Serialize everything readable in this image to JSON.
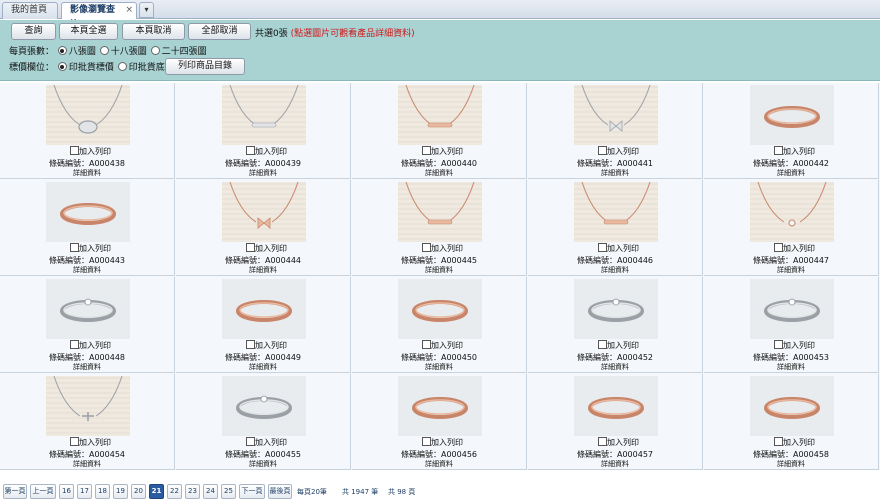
{
  "tabs": {
    "home": "我的首頁",
    "active": "影像瀏覽查詢",
    "close": "×",
    "menu": "▾"
  },
  "toolbar": {
    "query": "查詢",
    "select_page": "本頁全選",
    "cancel_page": "本頁取消",
    "cancel_all": "全部取消",
    "total": "共選0張",
    "hint": "(點選圖片可觀看產品詳細資料)",
    "print_catalog": "列印商品目錄"
  },
  "options": {
    "per_page_label": "每頁張數：",
    "per_page": [
      "八張圖",
      "十八張圖",
      "二十四張圖"
    ],
    "price_label": "標價欄位：",
    "price": [
      "印批貨標價",
      "印批貨底價"
    ]
  },
  "product_labels": {
    "add_print": "加入列印",
    "code_prefix": "條碼編號：",
    "detail": "詳細資料"
  },
  "products": [
    {
      "code": "A000438",
      "kind": "necklace",
      "metal": "silver",
      "charm": "oval"
    },
    {
      "code": "A000439",
      "kind": "necklace",
      "metal": "silver",
      "charm": "bar"
    },
    {
      "code": "A000440",
      "kind": "necklace",
      "metal": "rose",
      "charm": "bar"
    },
    {
      "code": "A000441",
      "kind": "necklace",
      "metal": "silver",
      "charm": "bow"
    },
    {
      "code": "A000442",
      "kind": "ring",
      "metal": "rose"
    },
    {
      "code": "A000443",
      "kind": "ring",
      "metal": "rose"
    },
    {
      "code": "A000444",
      "kind": "necklace",
      "metal": "rose",
      "charm": "bow"
    },
    {
      "code": "A000445",
      "kind": "necklace",
      "metal": "rose",
      "charm": "bar"
    },
    {
      "code": "A000446",
      "kind": "necklace",
      "metal": "rose",
      "charm": "bar"
    },
    {
      "code": "A000447",
      "kind": "necklace",
      "metal": "rose",
      "charm": "heart"
    },
    {
      "code": "A000448",
      "kind": "ring",
      "metal": "silver"
    },
    {
      "code": "A000449",
      "kind": "ring",
      "metal": "rose"
    },
    {
      "code": "A000450",
      "kind": "ring",
      "metal": "rose"
    },
    {
      "code": "A000452",
      "kind": "ring",
      "metal": "silver"
    },
    {
      "code": "A000453",
      "kind": "ring",
      "metal": "silver"
    },
    {
      "code": "A000454",
      "kind": "necklace",
      "metal": "silver",
      "charm": "cross"
    },
    {
      "code": "A000455",
      "kind": "ring",
      "metal": "silver"
    },
    {
      "code": "A000456",
      "kind": "ring",
      "metal": "rose"
    },
    {
      "code": "A000457",
      "kind": "ring",
      "metal": "rose"
    },
    {
      "code": "A000458",
      "kind": "ring",
      "metal": "rose"
    }
  ],
  "pager": {
    "first": "第一頁",
    "prev": "上一頁",
    "pages": [
      "16",
      "17",
      "18",
      "19",
      "20",
      "21",
      "22",
      "23",
      "24",
      "25"
    ],
    "current": "21",
    "next": "下一頁",
    "last": "最後頁",
    "per_page_text": "每頁20筆",
    "total_records": "共 1947 筆",
    "total_pages": "共 98 頁"
  }
}
